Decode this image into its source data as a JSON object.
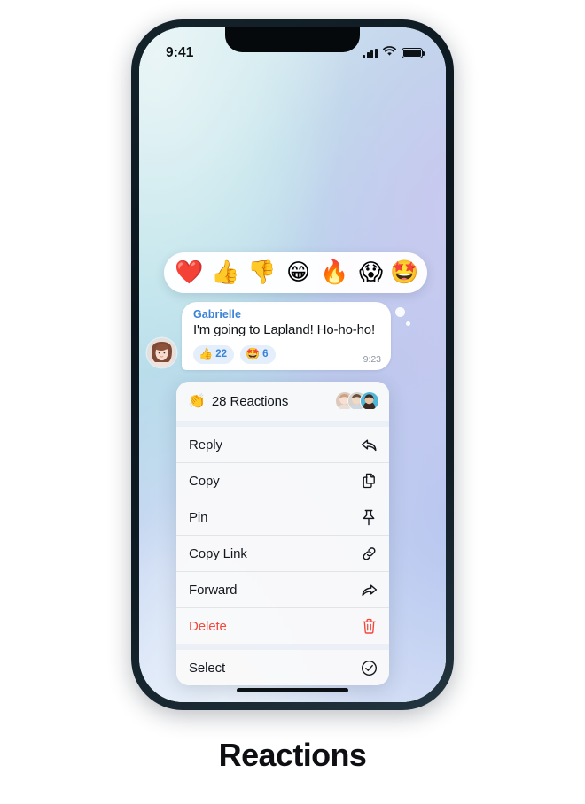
{
  "caption": "Reactions",
  "status_bar": {
    "time": "9:41",
    "cellular_icon": "cellular-bars-icon",
    "wifi_icon": "wifi-icon",
    "battery_icon": "battery-full-icon"
  },
  "reaction_bar": {
    "emojis": [
      {
        "name": "heart-emoji",
        "glyph": "❤️"
      },
      {
        "name": "thumbs-up-emoji",
        "glyph": "👍"
      },
      {
        "name": "thumbs-down-emoji",
        "glyph": "👎"
      },
      {
        "name": "grinning-face-emoji",
        "glyph": "😁"
      },
      {
        "name": "fire-emoji",
        "glyph": "🔥"
      },
      {
        "name": "screaming-face-emoji",
        "glyph": "😱"
      },
      {
        "name": "star-struck-emoji",
        "glyph": "🤩"
      }
    ]
  },
  "message": {
    "sender": "Gabrielle",
    "text": "I'm going to Lapland! Ho-ho-ho!",
    "time": "9:23",
    "reactions": [
      {
        "name": "thumbs-up-reaction",
        "emoji": "👍",
        "count": "22"
      },
      {
        "name": "star-struck-reaction",
        "emoji": "🤩",
        "count": "6"
      }
    ]
  },
  "context_menu": {
    "header": {
      "icon": "clapping-hands-icon",
      "icon_glyph": "👏",
      "label": "28 Reactions",
      "avatar_count": 3
    },
    "items": [
      {
        "label": "Reply",
        "icon": "reply-arrow-icon",
        "destructive": false
      },
      {
        "label": "Copy",
        "icon": "copy-pages-icon",
        "destructive": false
      },
      {
        "label": "Pin",
        "icon": "pushpin-icon",
        "destructive": false
      },
      {
        "label": "Copy Link",
        "icon": "link-chain-icon",
        "destructive": false
      },
      {
        "label": "Forward",
        "icon": "forward-arrow-icon",
        "destructive": false
      },
      {
        "label": "Delete",
        "icon": "trash-icon",
        "destructive": true
      },
      {
        "label": "Select",
        "icon": "check-circle-icon",
        "destructive": false
      }
    ]
  },
  "colors": {
    "accent_blue": "#3b82d6",
    "destructive_red": "#f2483c",
    "pill_bg": "#e4effb",
    "frame": "#15232b"
  }
}
